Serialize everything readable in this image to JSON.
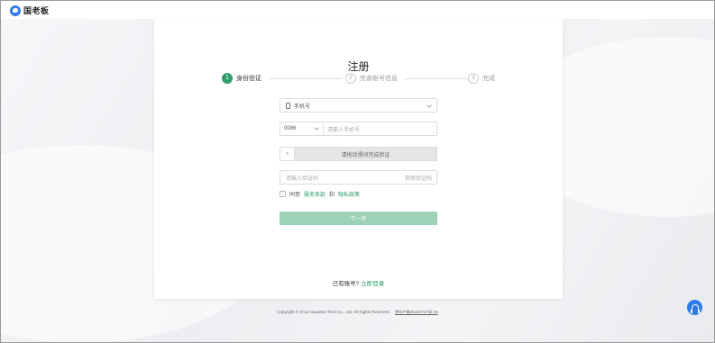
{
  "brand": {
    "name": "国老板",
    "logo_icon": "chat-bubble-icon",
    "color": "#2f7bea"
  },
  "page": {
    "title": "注册"
  },
  "steps": [
    {
      "num": "1",
      "label": "身份验证",
      "active": true
    },
    {
      "num": "2",
      "label": "完善账号信息",
      "active": false
    },
    {
      "num": "3",
      "label": "完成",
      "active": false
    }
  ],
  "form": {
    "method_select": {
      "value": "手机号",
      "icon": "phone-icon"
    },
    "country_code": "0086",
    "phone_placeholder": "请输入手机号",
    "slider_text": "请拖动滑块完成验证",
    "slider_handle": "»",
    "code_placeholder": "请输入验证码",
    "get_code": "获取验证码",
    "agree_prefix": "同意",
    "agree_terms": "服务条款",
    "agree_and": "和",
    "agree_privacy": "隐私政策",
    "next_button": "下一步"
  },
  "login": {
    "prompt": "已有账号?",
    "link": "立即登录"
  },
  "footer": {
    "copyright": "Copyright © Xi'an NovaStar Tech Co., Ltd. All Rights Reserved.",
    "icp": "陕ICP备05102747号-15"
  },
  "support": {
    "icon": "headset-icon"
  },
  "colors": {
    "accent": "#2e9e6a",
    "button_disabled": "#9ed2b6"
  }
}
